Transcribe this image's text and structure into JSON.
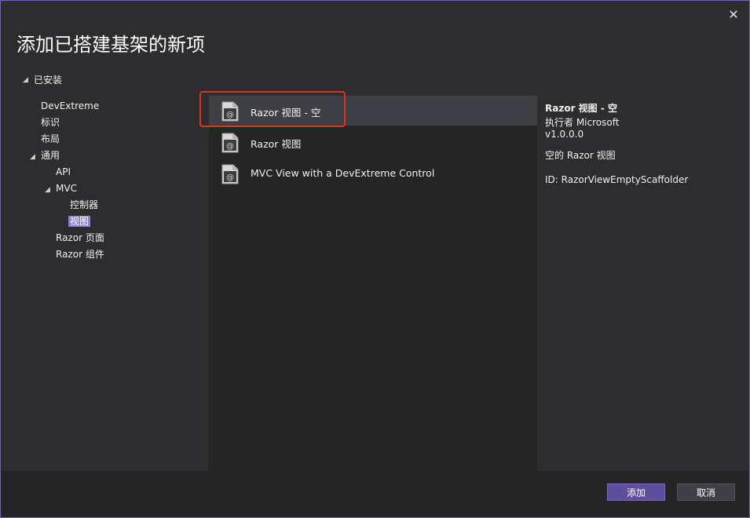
{
  "window": {
    "title": "添加已搭建基架的新项",
    "close_glyph": "✕"
  },
  "tree": {
    "installed_label": "已安装",
    "items": [
      {
        "label": "DevExtreme"
      },
      {
        "label": "标识"
      },
      {
        "label": "布局"
      },
      {
        "label": "通用"
      },
      {
        "label": "API"
      },
      {
        "label": "MVC"
      },
      {
        "label": "控制器"
      },
      {
        "label": "视图",
        "selected": true
      },
      {
        "label": "Razor 页面"
      },
      {
        "label": "Razor 组件"
      }
    ]
  },
  "templates": [
    {
      "label": "Razor 视图 - 空",
      "selected": true,
      "icon": "razor-file-icon"
    },
    {
      "label": "Razor 视图",
      "icon": "razor-file-icon"
    },
    {
      "label": "MVC View with a DevExtreme Control",
      "icon": "razor-file-icon"
    }
  ],
  "details": {
    "name": "Razor 视图 - 空",
    "author": "执行者 Microsoft",
    "version": "v1.0.0.0",
    "description": "空的 Razor 视图",
    "id": "ID: RazorViewEmptyScaffolder"
  },
  "buttons": {
    "add": "添加",
    "cancel": "取消"
  },
  "colors": {
    "accent": "#8e80d9",
    "highlight_border": "#e0301e",
    "dialog_border": "#7160c8"
  }
}
